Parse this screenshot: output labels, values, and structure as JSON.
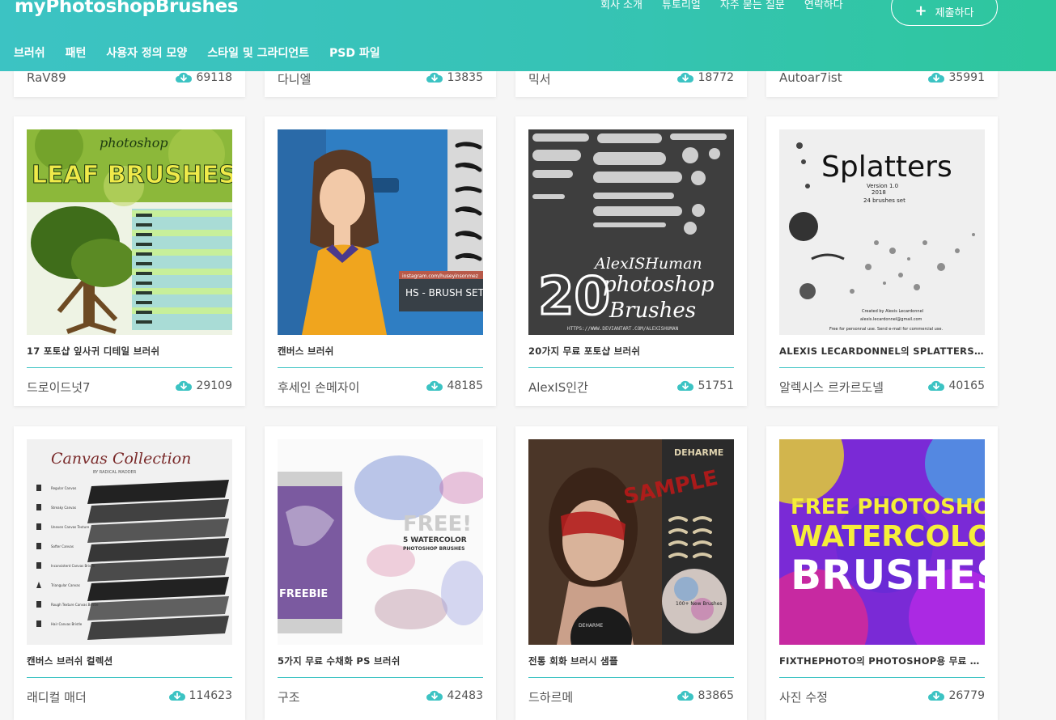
{
  "header": {
    "logo": "myPhotoshopBrushes",
    "top_nav": [
      "회사 소개",
      "튜토리얼",
      "자주 묻는 질문",
      "연락하다"
    ],
    "submit_label": "제출하다",
    "categories": [
      "브러쉬",
      "패턴",
      "사용자 정의 모양",
      "스타일 및 그라디언트",
      "PSD 파일"
    ]
  },
  "partial_row": [
    {
      "author": "RaV89",
      "downloads": "69118"
    },
    {
      "author": "다니엘",
      "downloads": "13835"
    },
    {
      "author": "믹서",
      "downloads": "18772"
    },
    {
      "author": "Autoar7ist",
      "downloads": "35991"
    }
  ],
  "cards": [
    {
      "title": "17 포토샵 잎사귀 디테일 브러쉬",
      "author": "드로이드넛7",
      "downloads": "29109",
      "thumb_text": [
        "photoshop",
        "LEAF BRUSHES"
      ]
    },
    {
      "title": "캔버스 브러쉬",
      "author": "후세인 손메자이",
      "downloads": "48185",
      "thumb_text": [
        "instagram.com/huseyinsonmez",
        "HS - BRUSH SET"
      ]
    },
    {
      "title": "20가지 무료 포토샵 브러쉬",
      "author": "AlexIS인간",
      "downloads": "51751",
      "thumb_text": [
        "AlexISHuman",
        "20",
        "photoshop",
        "Brushes",
        "HTTPS://WWW.DEVIANTART.COM/ALEXISHUMAN"
      ]
    },
    {
      "title": "ALEXIS LECARDONNEL의 SPLATTERS 브러쉬",
      "author": "알렉시스 르카르도넬",
      "downloads": "40165",
      "thumb_text": [
        "Splatters",
        "Version 1.0",
        "2018",
        "24 brushes set",
        "Created by Alexis Lecardonnel",
        "alexis.lecardonnel@gmail.com",
        "Free for personnal use. Send e-mail for commercial use."
      ]
    },
    {
      "title": "캔버스 브러쉬 컬렉션",
      "author": "래디컬 매더",
      "downloads": "114623",
      "thumb_text": [
        "Canvas Collection",
        "BY RADICAL MADDER",
        "Regular Canvas",
        "Streaky Canvas",
        "Uneven Canvas Texture",
        "Softer Canvas",
        "Inconsistent Canvas Bristle",
        "Triangular Canvas",
        "Rough Texture Canvas Bristle",
        "Hair Canvas Bristle"
      ]
    },
    {
      "title": "5가지 무료 수채화 PS 브러쉬",
      "author": "구조",
      "downloads": "42483",
      "thumb_text": [
        "FREE!",
        "5 WATERCOLOR",
        "PHOTOSHOP BRUSHES",
        "FREEBIE"
      ]
    },
    {
      "title": "전통 회화 브러시 샘플",
      "author": "드하르메",
      "downloads": "83865",
      "thumb_text": [
        "DEHARME",
        "SAMPLE",
        "100+ New Brushes",
        "DEHARME"
      ]
    },
    {
      "title": "FIXTHEPHOTO의 PHOTOSHOP용 무료 수채화 브러쉬",
      "author": "사진 수정",
      "downloads": "26779",
      "thumb_text": [
        "FREE PHOTOSHOP",
        "WATERCOLOR",
        "BRUSHES"
      ]
    }
  ],
  "colors": {
    "accent": "#3cc3c3",
    "header_end": "#2ec79d"
  }
}
